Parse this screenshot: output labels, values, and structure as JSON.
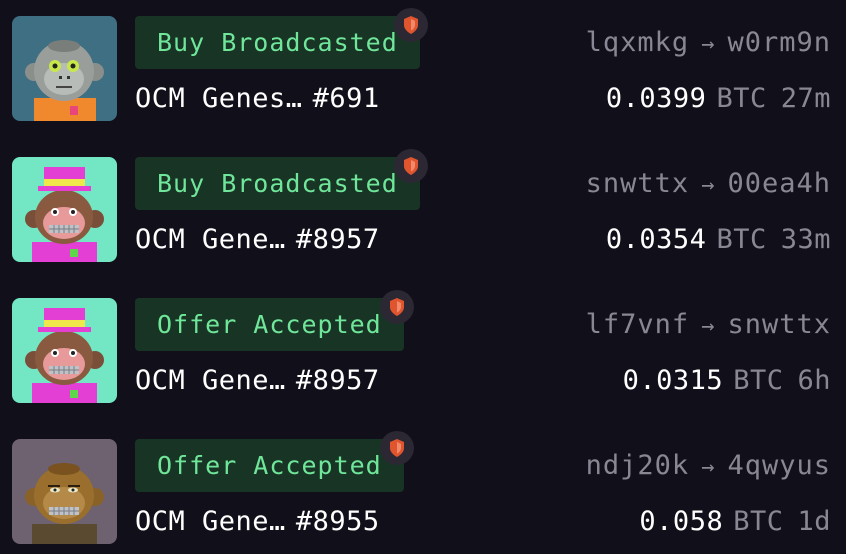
{
  "activity": [
    {
      "status": "Buy Broadcasted",
      "collection": "OCM Genes…",
      "token": "#691",
      "from": "lqxmkg",
      "to": "w0rm9n",
      "amount": "0.0399",
      "currency": "BTC",
      "age": "27m",
      "image_icon": "gray-monkey-avatar",
      "bg_color": "#3e6f82"
    },
    {
      "status": "Buy Broadcasted",
      "collection": "OCM Gene…",
      "token": "#8957",
      "from": "snwttx",
      "to": "00ea4h",
      "amount": "0.0354",
      "currency": "BTC",
      "age": "33m",
      "image_icon": "pink-hat-monkey-avatar",
      "bg_color": "#73e6c3"
    },
    {
      "status": "Offer Accepted",
      "collection": "OCM Gene…",
      "token": "#8957",
      "from": "lf7vnf",
      "to": "snwttx",
      "amount": "0.0315",
      "currency": "BTC",
      "age": "6h",
      "image_icon": "pink-hat-monkey-avatar",
      "bg_color": "#73e6c3"
    },
    {
      "status": "Offer Accepted",
      "collection": "OCM Gene…",
      "token": "#8955",
      "from": "ndj20k",
      "to": "4qwyus",
      "amount": "0.058",
      "currency": "BTC",
      "age": "1d",
      "image_icon": "brown-monkey-avatar",
      "bg_color": "#6e6170"
    }
  ],
  "colors": {
    "background": "#110f19",
    "badge_bg": "#183424",
    "badge_text": "#6fe69a",
    "muted_text": "#8a8794",
    "shield_accent": "#e0552e"
  },
  "icons": {
    "arrow": "→",
    "shield": "shield-icon"
  }
}
